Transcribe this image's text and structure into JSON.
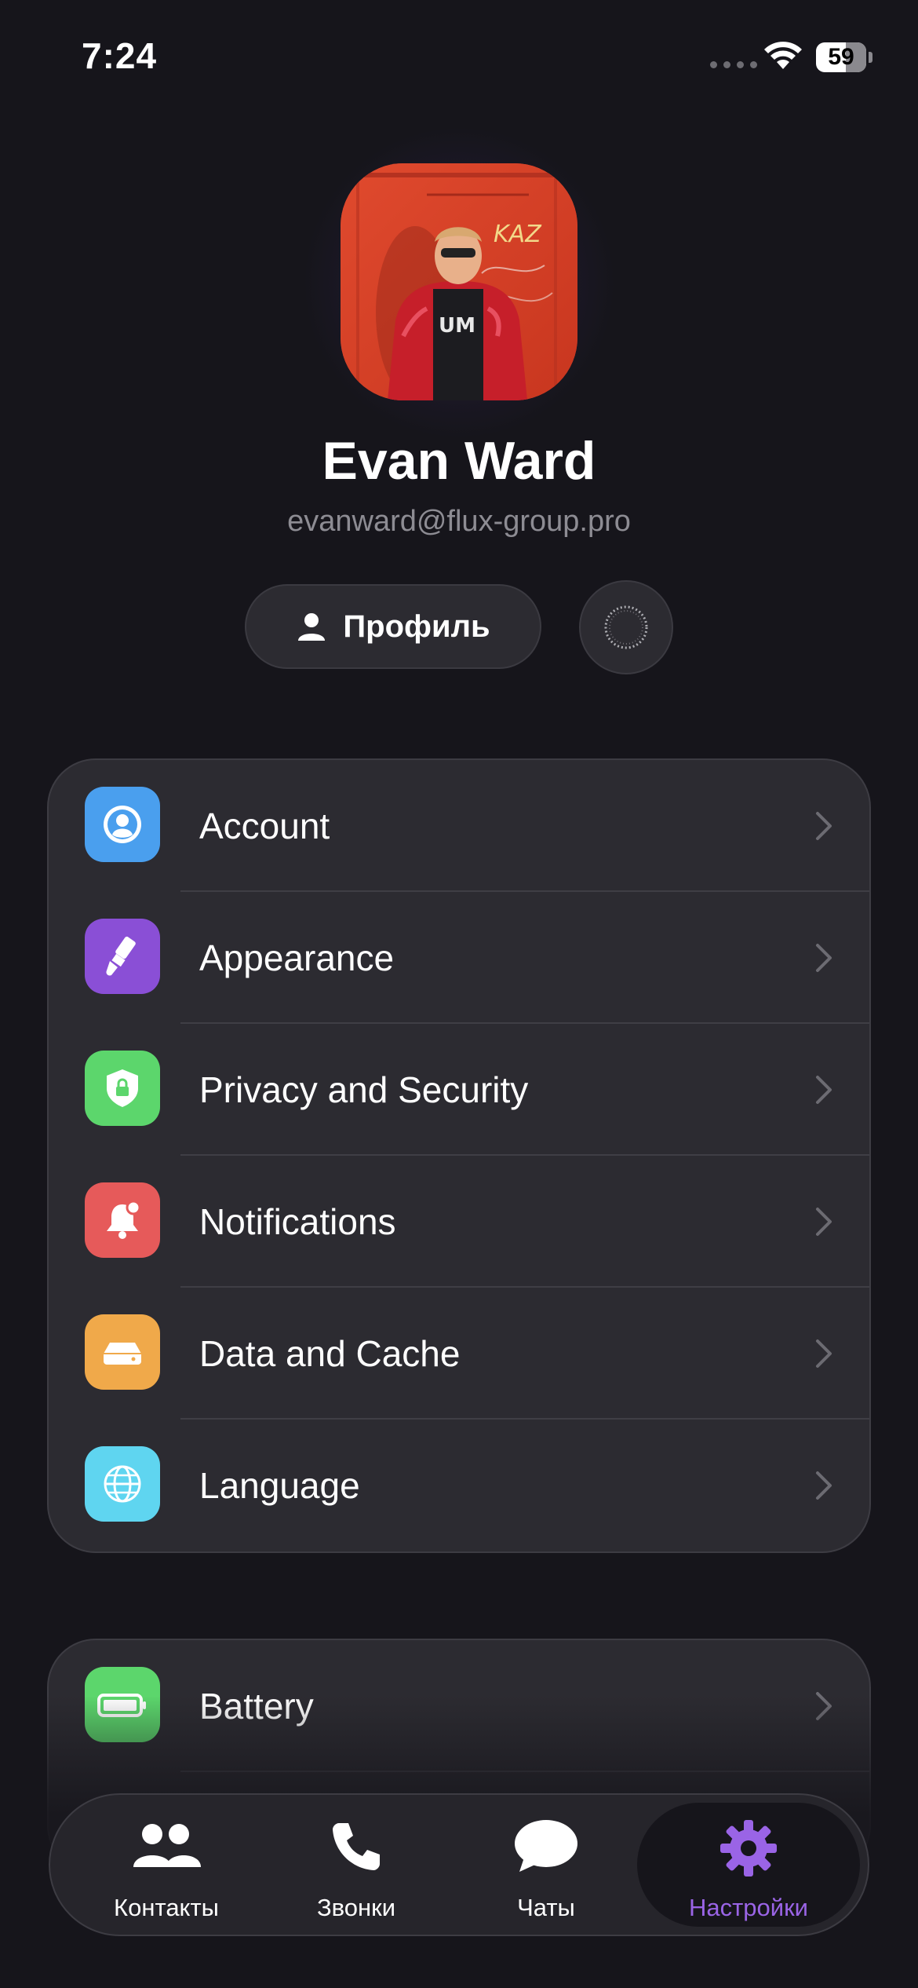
{
  "status_bar": {
    "time": "7:24",
    "battery": "59",
    "battery_level": 0.59
  },
  "profile": {
    "name": "Evan Ward",
    "email": "evanward@flux-group.pro",
    "profile_button_label": "Профиль"
  },
  "settings": {
    "items": [
      {
        "label": "Account",
        "icon": "person-circle-icon",
        "color": "#4a9fee"
      },
      {
        "label": "Appearance",
        "icon": "paintbrush-icon",
        "color": "#8a4fd6"
      },
      {
        "label": "Privacy and Security",
        "icon": "shield-lock-icon",
        "color": "#5cd66c"
      },
      {
        "label": "Notifications",
        "icon": "bell-badge-icon",
        "color": "#e65a5a"
      },
      {
        "label": "Data and Cache",
        "icon": "drive-icon",
        "color": "#f0a94a"
      },
      {
        "label": "Language",
        "icon": "globe-icon",
        "color": "#5fd5f0"
      }
    ],
    "secondary": [
      {
        "label": "Battery",
        "icon": "battery-icon",
        "color": "#5cd66c"
      }
    ]
  },
  "tab_bar": {
    "tabs": [
      {
        "label": "Контакты",
        "icon": "contacts-icon"
      },
      {
        "label": "Звонки",
        "icon": "phone-icon"
      },
      {
        "label": "Чаты",
        "icon": "chat-bubble-icon"
      },
      {
        "label": "Настройки",
        "icon": "gear-icon",
        "active": true
      }
    ],
    "active_color": "#9a64e6"
  }
}
